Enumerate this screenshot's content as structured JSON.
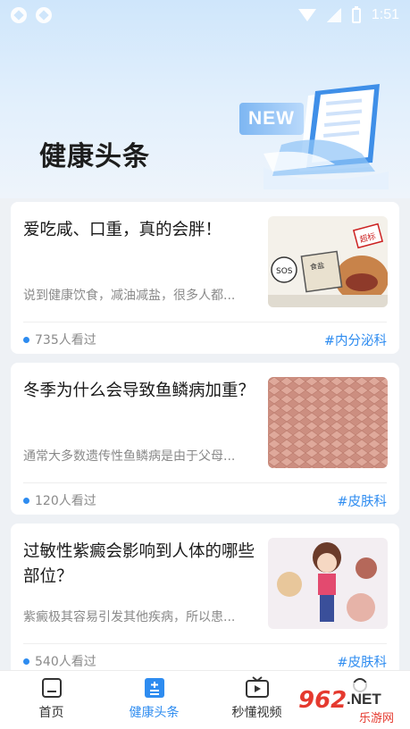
{
  "status_bar": {
    "time": "1:51"
  },
  "header": {
    "title": "健康头条",
    "badge": "NEW"
  },
  "articles": [
    {
      "title": "爱吃咸、口重，真的会胖！",
      "desc": "说到健康饮食，减油减盐，很多人都...",
      "views": "735人看过",
      "tag": "#内分泌科",
      "thumb_label_1": "SOS",
      "thumb_label_2": "超标",
      "thumb_label_3": "食盐"
    },
    {
      "title": "冬季为什么会导致鱼鳞病加重？",
      "desc": "通常大多数遗传性鱼鳞病是由于父母...",
      "views": "120人看过",
      "tag": "#皮肤科"
    },
    {
      "title": "过敏性紫癜会影响到人体的哪些部位？",
      "desc": "紫癜极其容易引发其他疾病，所以患...",
      "views": "540人看过",
      "tag": "#皮肤科"
    }
  ],
  "tabbar": {
    "tabs": [
      {
        "label": "首页"
      },
      {
        "label": "健康头条"
      },
      {
        "label": "秒懂视频"
      },
      {
        "label": ""
      }
    ]
  },
  "watermark": {
    "main": "962",
    "suffix": ".NET",
    "sub": "乐游网"
  },
  "colors": {
    "accent": "#2e8cf0",
    "header_bg": "#cfe6fb"
  }
}
